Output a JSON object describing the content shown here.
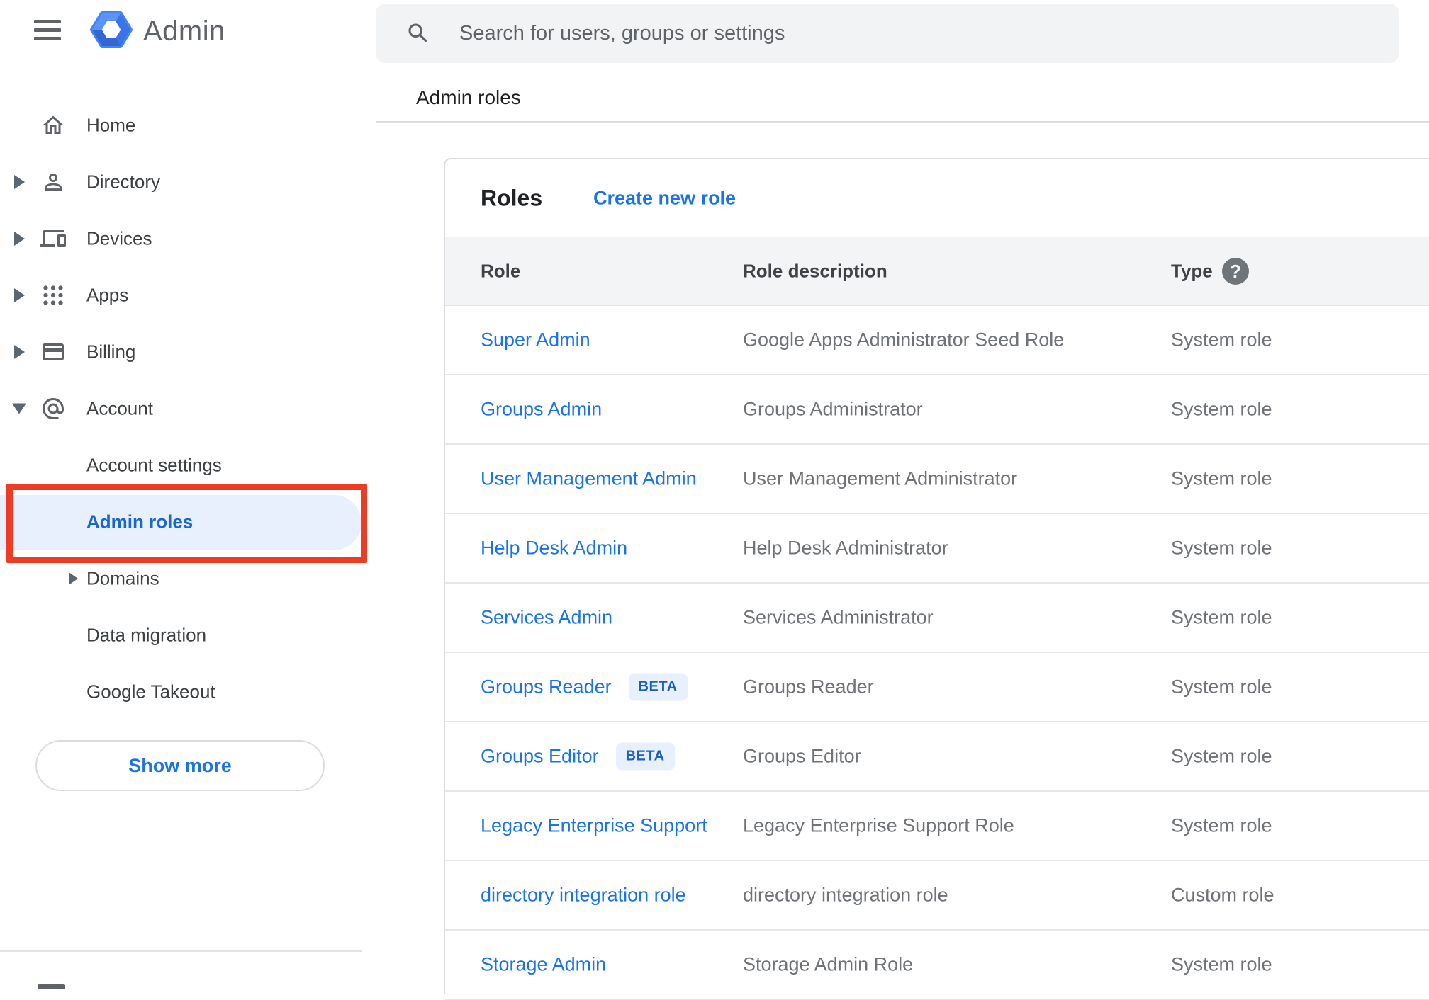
{
  "header": {
    "logo_text": "Admin"
  },
  "search": {
    "placeholder": "Search for users, groups or settings"
  },
  "breadcrumb": {
    "label": "Admin roles"
  },
  "sidebar": {
    "items": [
      {
        "label": "Home",
        "icon": "home",
        "arrow": "none",
        "indent": 0,
        "selected": false
      },
      {
        "label": "Directory",
        "icon": "person",
        "arrow": "right",
        "indent": 0,
        "selected": false
      },
      {
        "label": "Devices",
        "icon": "devices",
        "arrow": "right",
        "indent": 0,
        "selected": false
      },
      {
        "label": "Apps",
        "icon": "apps",
        "arrow": "right",
        "indent": 0,
        "selected": false
      },
      {
        "label": "Billing",
        "icon": "credit-card",
        "arrow": "right",
        "indent": 0,
        "selected": false
      },
      {
        "label": "Account",
        "icon": "at-email",
        "arrow": "down",
        "indent": 0,
        "selected": false
      },
      {
        "label": "Account settings",
        "icon": "none",
        "arrow": "none",
        "indent": 1,
        "selected": false
      },
      {
        "label": "Admin roles",
        "icon": "none",
        "arrow": "none",
        "indent": 1,
        "selected": true
      },
      {
        "label": "Domains",
        "icon": "none",
        "arrow": "right-inline",
        "indent": 1,
        "selected": false
      },
      {
        "label": "Data migration",
        "icon": "none",
        "arrow": "none",
        "indent": 1,
        "selected": false
      },
      {
        "label": "Google Takeout",
        "icon": "none",
        "arrow": "none",
        "indent": 1,
        "selected": false
      }
    ],
    "show_more_label": "Show more"
  },
  "panel": {
    "title": "Roles",
    "create_link": "Create new role",
    "columns": [
      "Role",
      "Role description",
      "Type"
    ],
    "rows": [
      {
        "role": "Super Admin",
        "badge": "",
        "description": "Google Apps Administrator Seed Role",
        "type": "System role"
      },
      {
        "role": "Groups Admin",
        "badge": "",
        "description": "Groups Administrator",
        "type": "System role"
      },
      {
        "role": "User Management Admin",
        "badge": "",
        "description": "User Management Administrator",
        "type": "System role"
      },
      {
        "role": "Help Desk Admin",
        "badge": "",
        "description": "Help Desk Administrator",
        "type": "System role"
      },
      {
        "role": "Services Admin",
        "badge": "",
        "description": "Services Administrator",
        "type": "System role"
      },
      {
        "role": "Groups Reader",
        "badge": "BETA",
        "description": "Groups Reader",
        "type": "System role"
      },
      {
        "role": "Groups Editor",
        "badge": "BETA",
        "description": "Groups Editor",
        "type": "System role"
      },
      {
        "role": "Legacy Enterprise Support",
        "badge": "",
        "description": "Legacy Enterprise Support Role",
        "type": "System role"
      },
      {
        "role": "directory integration role",
        "badge": "",
        "description": "directory integration role",
        "type": "Custom role"
      },
      {
        "role": "Storage Admin",
        "badge": "",
        "description": "Storage Admin Role",
        "type": "System role"
      }
    ]
  },
  "colors": {
    "accent_blue": "#1a73e8",
    "selected_blue": "#1967d2",
    "pill_bg": "#e8f0fe",
    "annotation_red": "#ee3b24",
    "icon_gray": "#5f6368"
  }
}
